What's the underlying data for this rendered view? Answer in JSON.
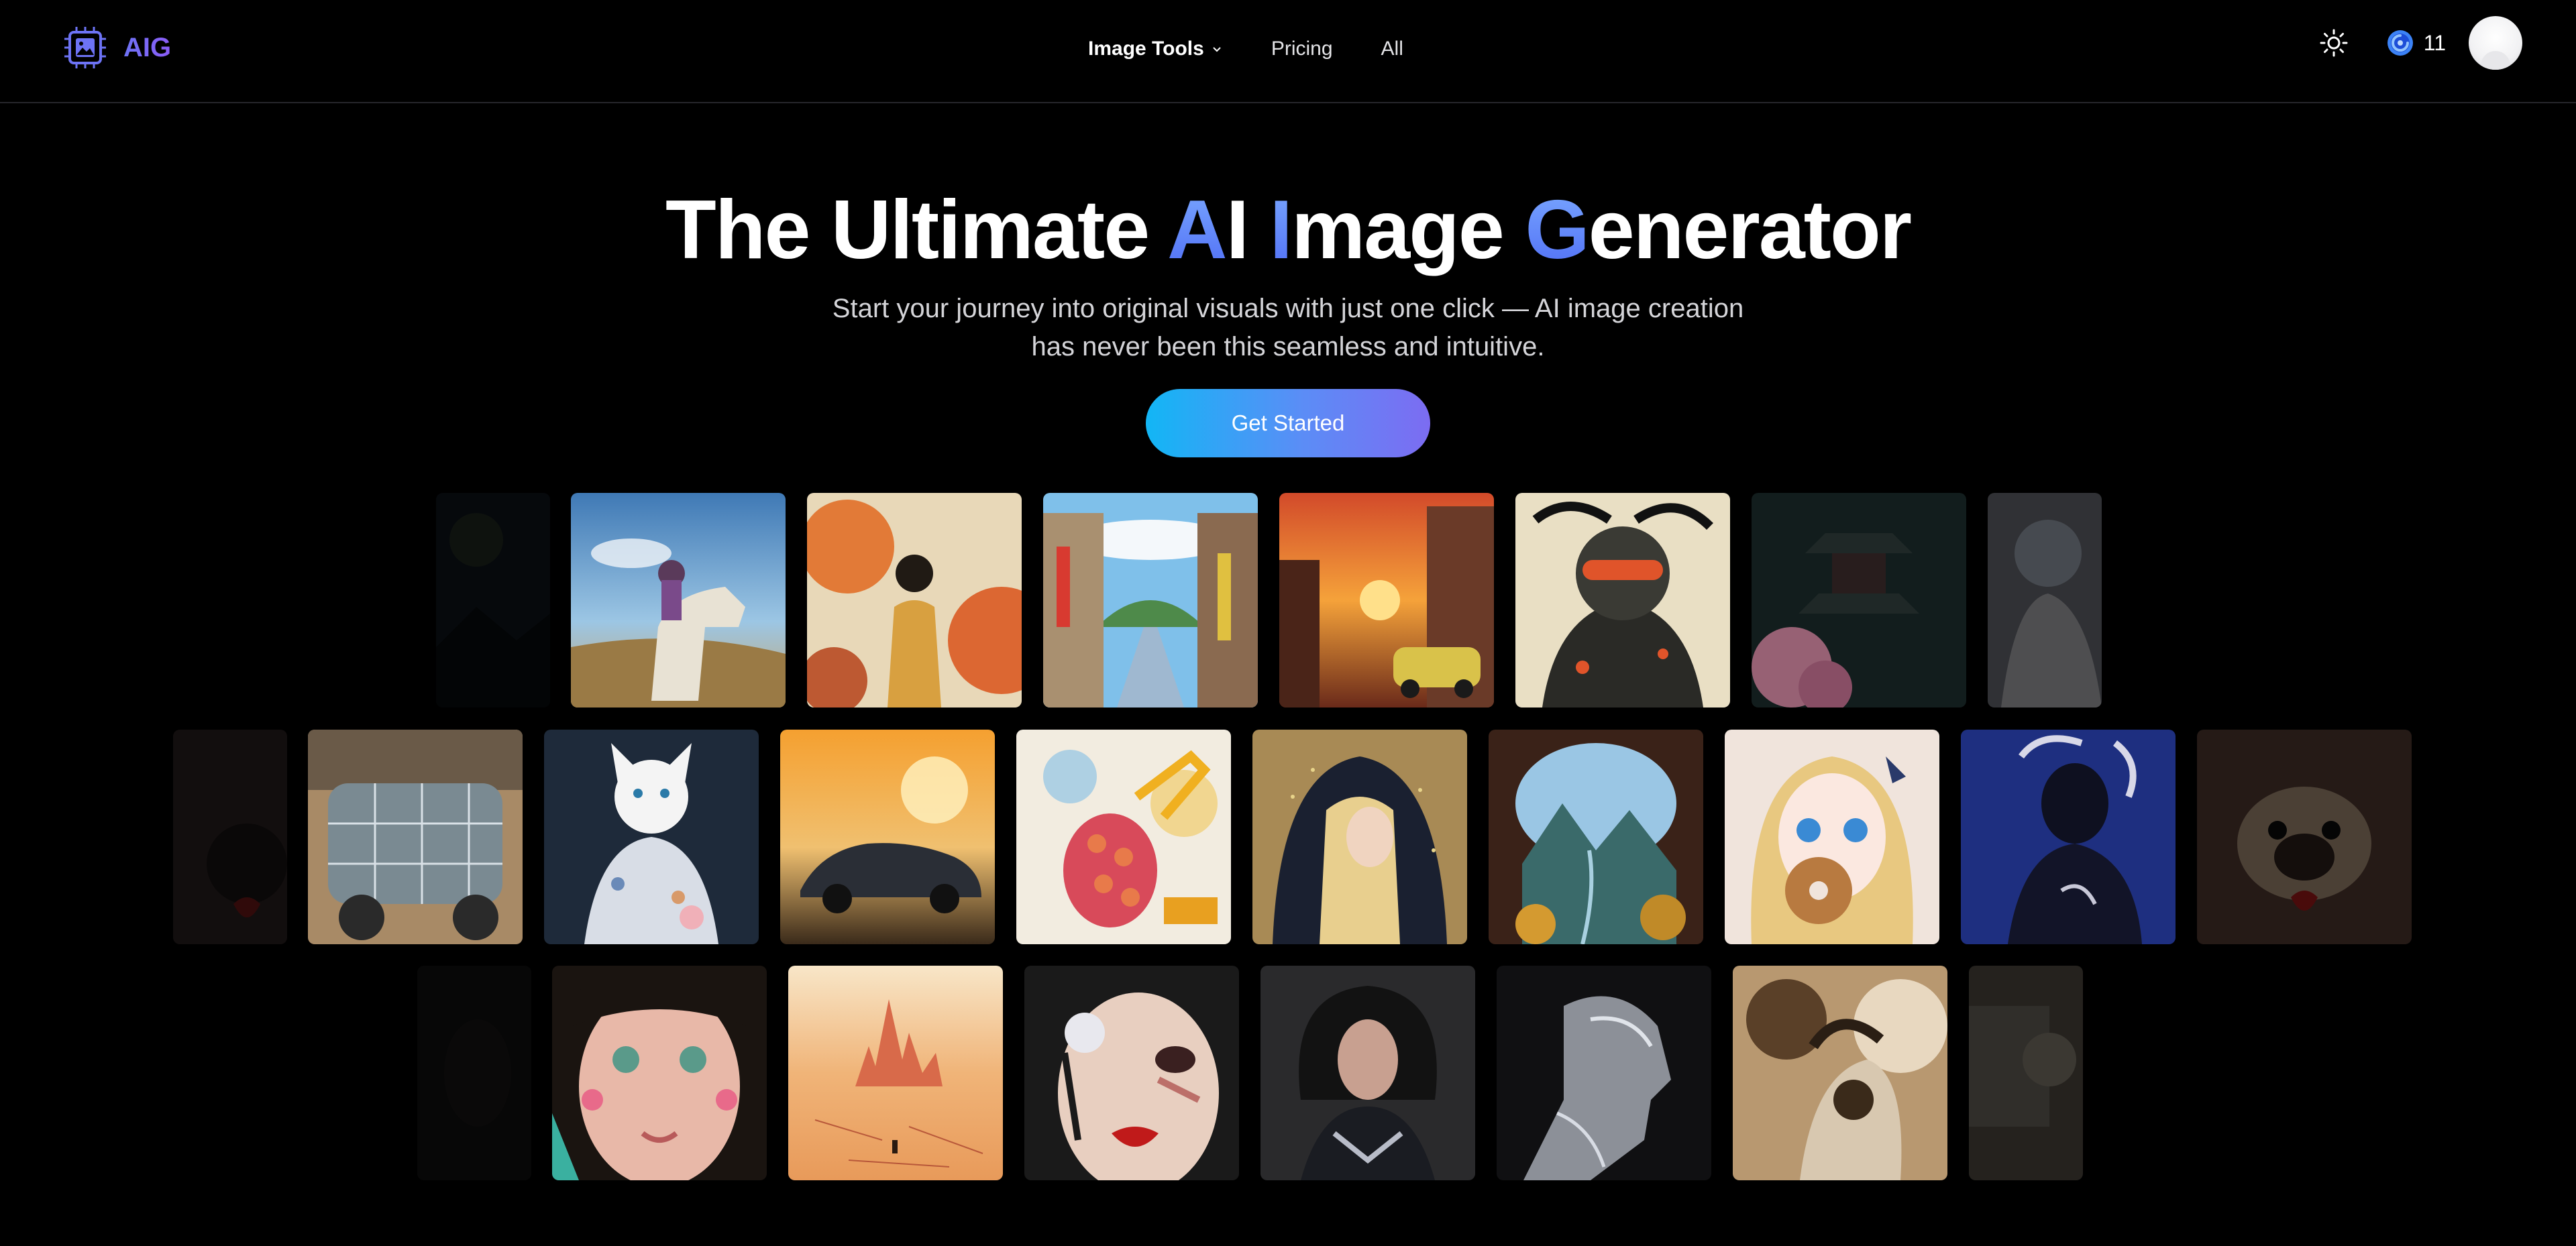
{
  "nav": {
    "logo_text": "AIG",
    "links": [
      {
        "label": "Image Tools",
        "has_dropdown": true
      },
      {
        "label": "Pricing"
      },
      {
        "label": "All"
      }
    ],
    "credits": "11",
    "icons": {
      "theme": "sun-icon",
      "credits": "credit-coin-icon",
      "logo": "chip-image-logo-icon",
      "dropdown": "chevron-down-icon"
    }
  },
  "hero": {
    "title_parts": [
      "The Ultimate ",
      "A",
      "I ",
      "I",
      "mage ",
      "G",
      "enerator"
    ],
    "subtitle": "Start your journey into original visuals with just one click — AI image creation has never been this seamless and intuitive.",
    "cta_label": "Get Started"
  },
  "gallery": {
    "rows": [
      [
        "dark-landscape",
        "cowgirl-on-horse",
        "autumn-girl",
        "japanese-street",
        "sunset-street-car",
        "cyber-girl-visor",
        "pagoda-cherry",
        "blue-hair-girl"
      ],
      [
        "pug-heart",
        "glass-wagon",
        "white-cat-kimono",
        "porsche-sunset",
        "grape-excavator",
        "hooded-elf",
        "mountain-cave",
        "anime-donut-girl",
        "dark-goddess",
        "pug-heart"
      ],
      [
        "dark-portrait",
        "green-eyed-girl",
        "desert-castle",
        "pearl-eye-face",
        "dark-warrior-woman",
        "silver-bust",
        "rocky-figure",
        "cat-in-box"
      ]
    ]
  },
  "colors": {
    "accent_start": "#12b6f5",
    "accent_end": "#7c6cf2",
    "logo": "#6d73f5",
    "background": "#000000"
  }
}
